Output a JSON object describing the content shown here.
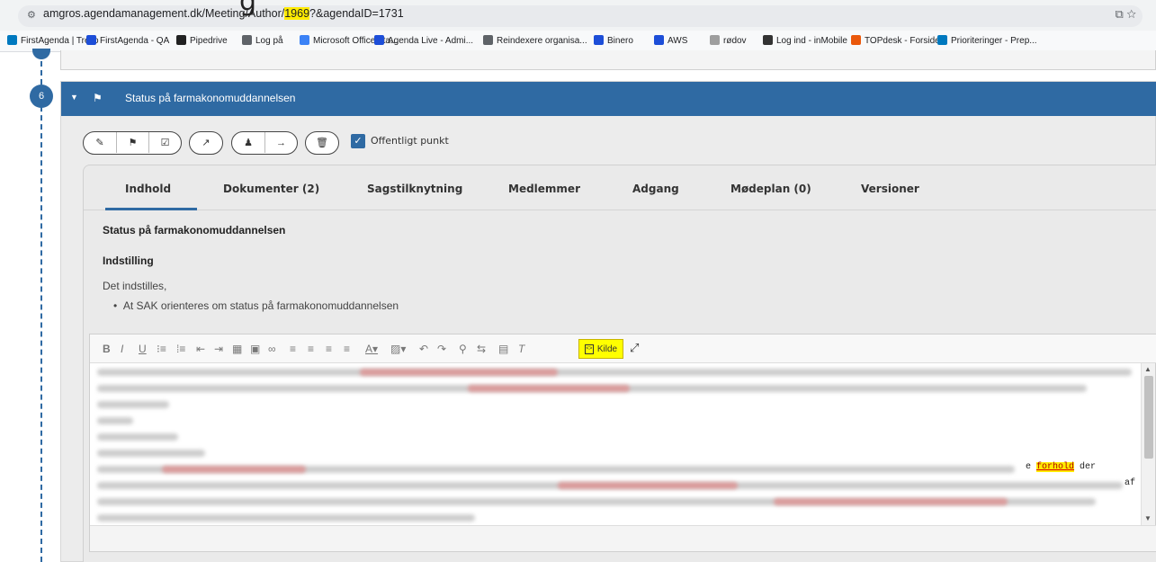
{
  "browser": {
    "url_before": "amgros.agendamanagement.dk/Meeting/Author/",
    "url_highlight": "1969",
    "url_after": "?&agendaID=1731",
    "overlay_glyph": "g"
  },
  "bookmarks": [
    {
      "label": "FirstAgenda | Trello",
      "color": "#0079bf"
    },
    {
      "label": "FirstAgenda - QA",
      "color": "#1d4ed8"
    },
    {
      "label": "Pipedrive",
      "color": "#222222"
    },
    {
      "label": "Log på",
      "color": "#5f6368"
    },
    {
      "label": "Microsoft Office-sta...",
      "color": "#3b82f6"
    },
    {
      "label": "Agenda Live - Admi...",
      "color": "#1d4ed8"
    },
    {
      "label": "Reindexere organisa...",
      "color": "#5f6368"
    },
    {
      "label": "Binero",
      "color": "#1d4ed8"
    },
    {
      "label": "AWS",
      "color": "#1d4ed8"
    },
    {
      "label": "rødov",
      "color": "#9e9e9e"
    },
    {
      "label": "Log ind - inMobile",
      "color": "#333333"
    },
    {
      "label": "TOPdesk - Forside",
      "color": "#ea580c"
    },
    {
      "label": "Prioriteringer - Prep...",
      "color": "#0079bf"
    }
  ],
  "timeline": {
    "step_number": "6"
  },
  "item": {
    "title": "Status på farmakonomuddannelsen",
    "public_label": "Offentligt punkt",
    "public_checked": true
  },
  "tabs": [
    {
      "label": "Indhold",
      "active": true
    },
    {
      "label": "Dokumenter (2)"
    },
    {
      "label": "Sagstilknytning"
    },
    {
      "label": "Medlemmer"
    },
    {
      "label": "Adgang"
    },
    {
      "label": "Mødeplan (0)"
    },
    {
      "label": "Versioner"
    }
  ],
  "content": {
    "title": "Status på farmakonomuddannelsen",
    "heading": "Indstilling",
    "text": "Det indstilles,",
    "bullet": "At SAK orienteres om status på farmakonomuddannelsen"
  },
  "editor": {
    "source_button_label": "Kilde",
    "visible_fragment_pre": "e ",
    "visible_fragment_mark": "forhold",
    "visible_fragment_post": " der",
    "visible_fragment_2": "af"
  },
  "colors": {
    "accent": "#2f6aa3",
    "highlight": "#ffeb00"
  }
}
